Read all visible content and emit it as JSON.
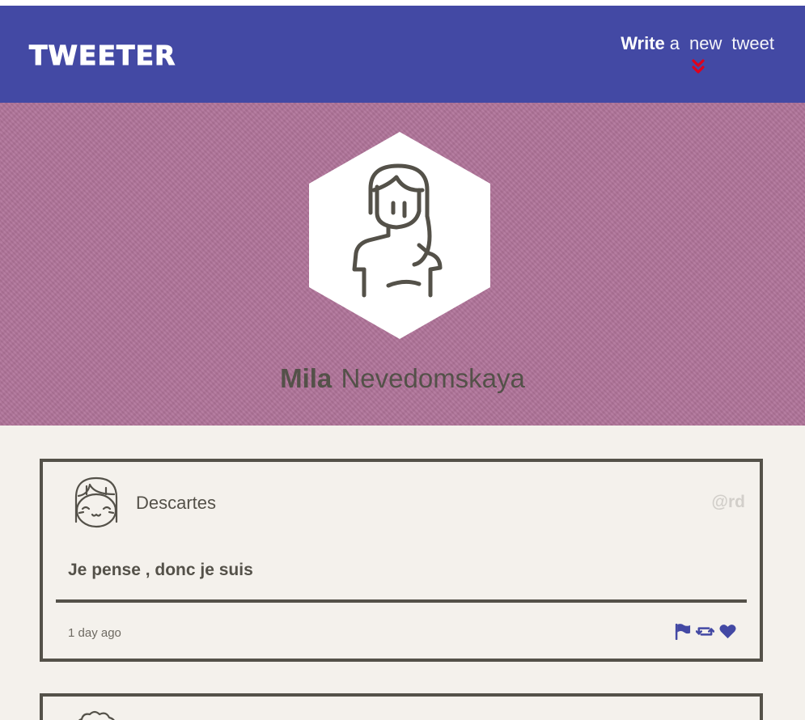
{
  "header": {
    "logo": "TWEETER",
    "compose": {
      "strong": "Write",
      "words": [
        "a",
        "new",
        "tweet"
      ]
    },
    "icons": {
      "compose_toggle": "double-chevron-down-icon"
    },
    "colors": {
      "background": "#4349a4",
      "chevron": "#e0001a"
    }
  },
  "profile": {
    "first_name": "Mila",
    "last_name": "Nevedomskaya",
    "avatar": "woman-avatar-icon",
    "colors": {
      "banner": "#b07399"
    }
  },
  "tweets": [
    {
      "name": "Descartes",
      "handle": "@rd",
      "text": "Je pense , donc je suis",
      "time": "1 day ago",
      "avatar": "girl-avatar-icon",
      "actions": [
        "flag-icon",
        "retweet-icon",
        "heart-icon"
      ]
    },
    {
      "avatar": "curly-hair-avatar-icon"
    }
  ],
  "colors": {
    "page": "#f4f1ec",
    "border": "#545149",
    "action": "#4349a4",
    "handle": "#d2cfca"
  }
}
